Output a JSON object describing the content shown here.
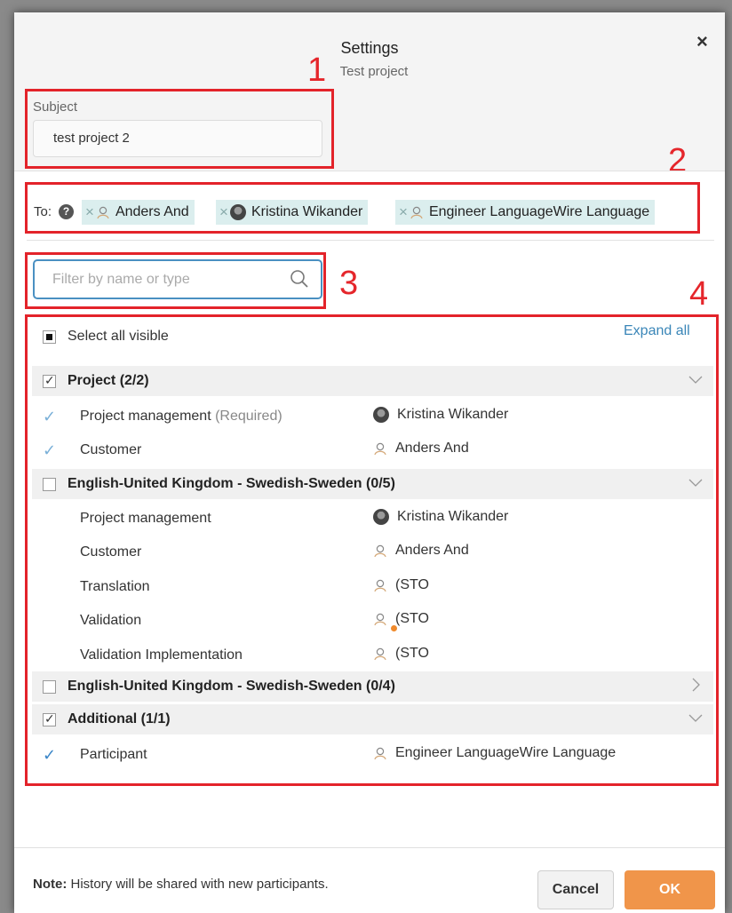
{
  "dialog": {
    "title": "Settings",
    "subtitle": "Test project",
    "close_label": "×"
  },
  "annotations": [
    "1",
    "2",
    "3",
    "4"
  ],
  "subject": {
    "label": "Subject",
    "value": "test project 2"
  },
  "to": {
    "label": "To:",
    "help_icon": "?",
    "chips": [
      {
        "name": "Anders And",
        "avatar": "line-avatar-icon"
      },
      {
        "name": "Kristina Wikander",
        "avatar": "photo-avatar-icon"
      },
      {
        "name": "Engineer LanguageWire Language",
        "avatar": "line-avatar-icon"
      }
    ]
  },
  "filter": {
    "placeholder": "Filter by name or type"
  },
  "select_all_label": "Select all visible",
  "expand_all_label": "Expand all",
  "groups": [
    {
      "title": "Project (2/2)",
      "state": "checked",
      "expanded": true,
      "rows": [
        {
          "role": "Project management",
          "note": "(Required)",
          "checked": true,
          "person": "Kristina Wikander",
          "avatar": "photo-avatar-icon"
        },
        {
          "role": "Customer",
          "note": "",
          "checked": true,
          "person": "Anders And",
          "avatar": "line-avatar-icon"
        }
      ]
    },
    {
      "title": "English-United Kingdom - Swedish-Sweden (0/5)",
      "state": "unchecked",
      "expanded": true,
      "rows": [
        {
          "role": "Project management",
          "checked": false,
          "person": "Kristina Wikander",
          "avatar": "photo-avatar-icon"
        },
        {
          "role": "Customer",
          "checked": false,
          "person": "Anders And",
          "avatar": "line-avatar-icon"
        },
        {
          "role": "Translation",
          "checked": false,
          "person": "(STO",
          "avatar": "line-avatar-icon"
        },
        {
          "role": "Validation",
          "checked": false,
          "person": "(STO",
          "avatar": "line-avatar-icon",
          "status_dot": "#f08a2c"
        },
        {
          "role": "Validation Implementation",
          "checked": false,
          "person": "(STO",
          "avatar": "line-avatar-icon"
        }
      ]
    },
    {
      "title": "English-United Kingdom - Swedish-Sweden (0/4)",
      "state": "unchecked",
      "expanded": false,
      "rows": []
    },
    {
      "title": "Additional (1/1)",
      "state": "checked",
      "expanded": true,
      "rows": [
        {
          "role": "Participant",
          "checked": true,
          "person": "Engineer LanguageWire Language",
          "avatar": "line-avatar-icon"
        }
      ]
    }
  ],
  "footer": {
    "note_bold": "Note:",
    "note_text": "History will be shared with new participants.",
    "cancel_label": "Cancel",
    "ok_label": "OK"
  },
  "colors": {
    "accent": "#3a86b8",
    "ok_button": "#f0954a",
    "chip_bg": "#dbeeee",
    "annotation_red": "#e3232a",
    "check_blue": "#7ab0d8"
  }
}
